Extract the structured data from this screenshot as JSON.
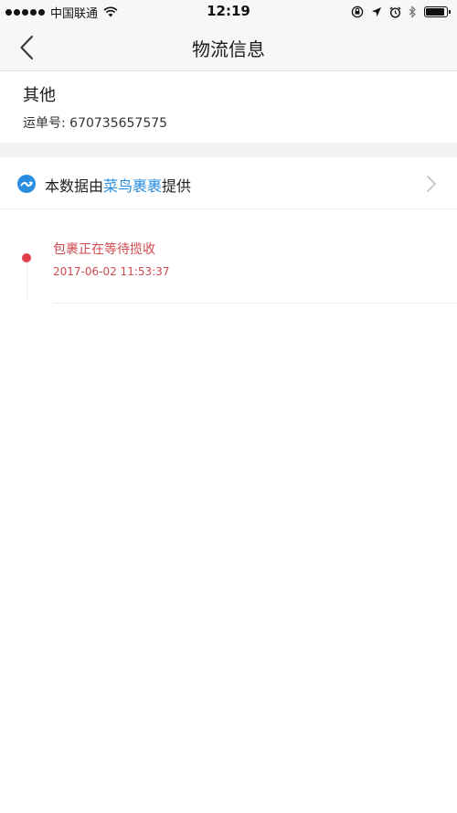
{
  "status_bar": {
    "carrier": "中国联通",
    "time": "12:19"
  },
  "nav": {
    "title": "物流信息"
  },
  "package": {
    "company": "其他",
    "tracking_label": "运单号: ",
    "tracking_number": "670735657575"
  },
  "provider": {
    "prefix": "本数据由",
    "name": "菜鸟裹裹",
    "suffix": "提供"
  },
  "timeline": {
    "events": [
      {
        "status": "包裹正在等待揽收",
        "time": "2017-06-02 11:53:37"
      }
    ]
  },
  "colors": {
    "accent_blue": "#2a8ee0",
    "event_red": "#e0414a"
  },
  "icons": {
    "back": "chevron-left-icon",
    "provider_logo": "cainiao-logo-icon",
    "row_arrow": "chevron-right-icon"
  }
}
